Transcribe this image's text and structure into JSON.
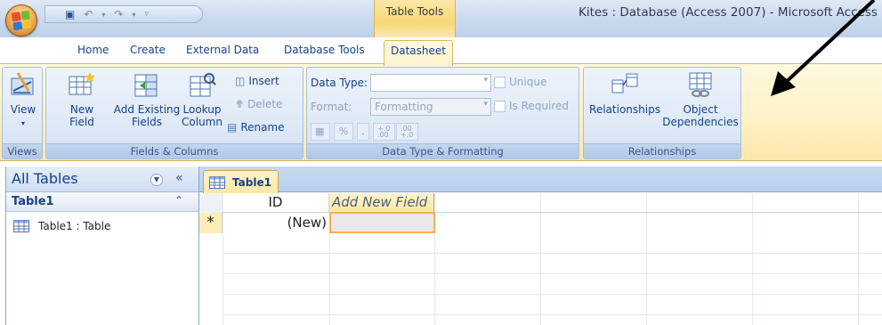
{
  "titlebar": {
    "contextual_tab_group": "Table Tools",
    "window_title": "Kites : Database (Access 2007) - Microsoft Access"
  },
  "tabs": [
    "Home",
    "Create",
    "External Data",
    "Database Tools",
    "Datasheet"
  ],
  "active_tab": "Datasheet",
  "ribbon": {
    "views": {
      "view_label": "View",
      "group_label": "Views"
    },
    "fields_columns": {
      "new_field_line1": "New",
      "new_field_line2": "Field",
      "add_existing_line1": "Add Existing",
      "add_existing_line2": "Fields",
      "lookup_line1": "Lookup",
      "lookup_line2": "Column",
      "insert_label": "Insert",
      "delete_label": "Delete",
      "rename_label": "Rename",
      "group_label": "Fields & Columns"
    },
    "data_type": {
      "data_type_label": "Data Type:",
      "data_type_value": "",
      "format_label": "Format:",
      "format_value": "Formatting",
      "unique_label": "Unique",
      "is_required_label": "Is Required",
      "percent_label": "%",
      "comma_label": ",",
      "increase_decimals_label": "+.0 .00",
      "decrease_decimals_label": ".00 +.0",
      "group_label": "Data Type & Formatting"
    },
    "relationships": {
      "relationships_label": "Relationships",
      "object_dependencies_line1": "Object",
      "object_dependencies_line2": "Dependencies",
      "group_label": "Relationships"
    }
  },
  "navpane": {
    "title": "All Tables",
    "group_title": "Table1",
    "item_label": "Table1 : Table"
  },
  "document": {
    "tab_label": "Table1",
    "columns": [
      "ID",
      "Add New Field"
    ],
    "new_row_marker": "*",
    "new_row_id": "(New)"
  },
  "colors": {
    "ribbon_bg": "#fff2c8",
    "group_bg": "#dde8f6",
    "accent_text": "#15428b",
    "selected_cell_border": "#f4b44c"
  }
}
